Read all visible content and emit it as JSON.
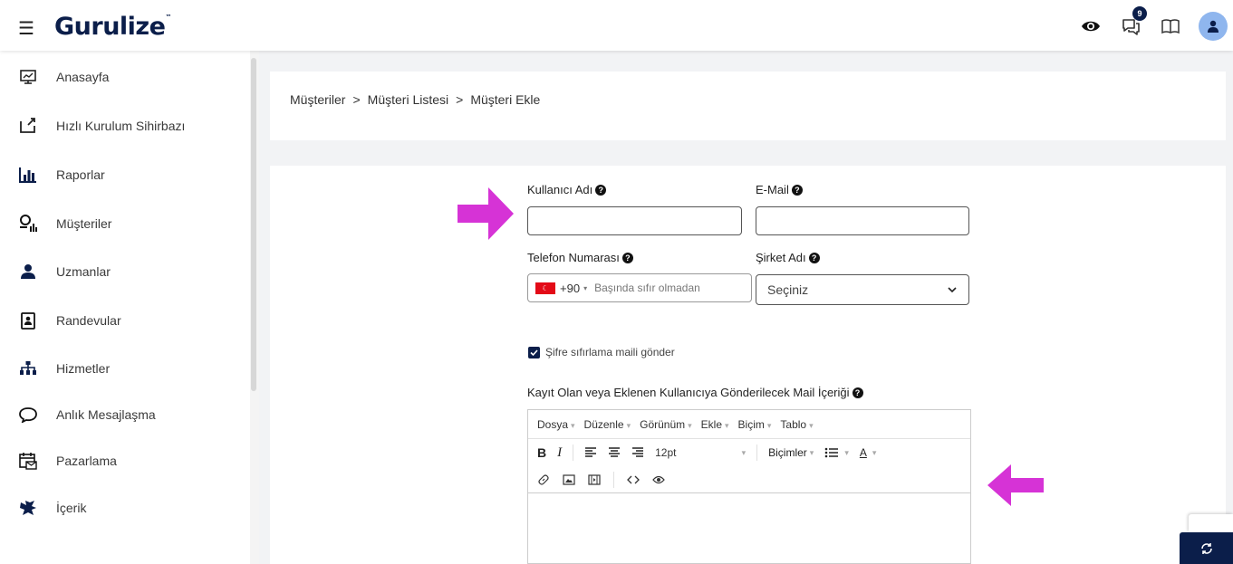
{
  "header": {
    "logo": "Gurulize",
    "notification_count": "9"
  },
  "sidebar": {
    "items": [
      {
        "label": "Anasayfa",
        "icon": "monitor-chart-icon"
      },
      {
        "label": "Hızlı Kurulum Sihirbazı",
        "icon": "setup-wizard-icon"
      },
      {
        "label": "Raporlar",
        "icon": "bar-chart-icon"
      },
      {
        "label": "Müşteriler",
        "icon": "customers-icon"
      },
      {
        "label": "Uzmanlar",
        "icon": "user-icon"
      },
      {
        "label": "Randevular",
        "icon": "clipboard-user-icon"
      },
      {
        "label": "Hizmetler",
        "icon": "sitemap-icon"
      },
      {
        "label": "Anlık Mesajlaşma",
        "icon": "chat-icon"
      },
      {
        "label": "Pazarlama",
        "icon": "calendar-mail-icon"
      },
      {
        "label": "İçerik",
        "icon": "puzzle-icon"
      }
    ]
  },
  "breadcrumb": [
    "Müşteriler",
    "Müşteri Listesi",
    "Müşteri Ekle"
  ],
  "breadcrumb_separator": ">",
  "form": {
    "username_label": "Kullanıcı Adı",
    "username_value": "",
    "email_label": "E-Mail",
    "email_value": "",
    "phone_label": "Telefon Numarası",
    "phone_code": "+90",
    "phone_placeholder": "Başında sıfır olmadan",
    "company_label": "Şirket Adı",
    "company_selected": "Seçiniz",
    "reset_mail_label": "Şifre sıfırlama maili gönder",
    "reset_mail_checked": true,
    "mail_content_label": "Kayıt Olan veya Eklenen Kullanıcıya Gönderilecek Mail İçeriği"
  },
  "editor": {
    "menus": [
      "Dosya",
      "Düzenle",
      "Görünüm",
      "Ekle",
      "Biçim",
      "Tablo"
    ],
    "bold": "B",
    "italic": "I",
    "font_size": "12pt",
    "formats": "Biçimler",
    "text_color": "A"
  },
  "colors": {
    "brand": "#0b1e4a",
    "arrow": "#d633d6",
    "flag": "#e30a17"
  }
}
